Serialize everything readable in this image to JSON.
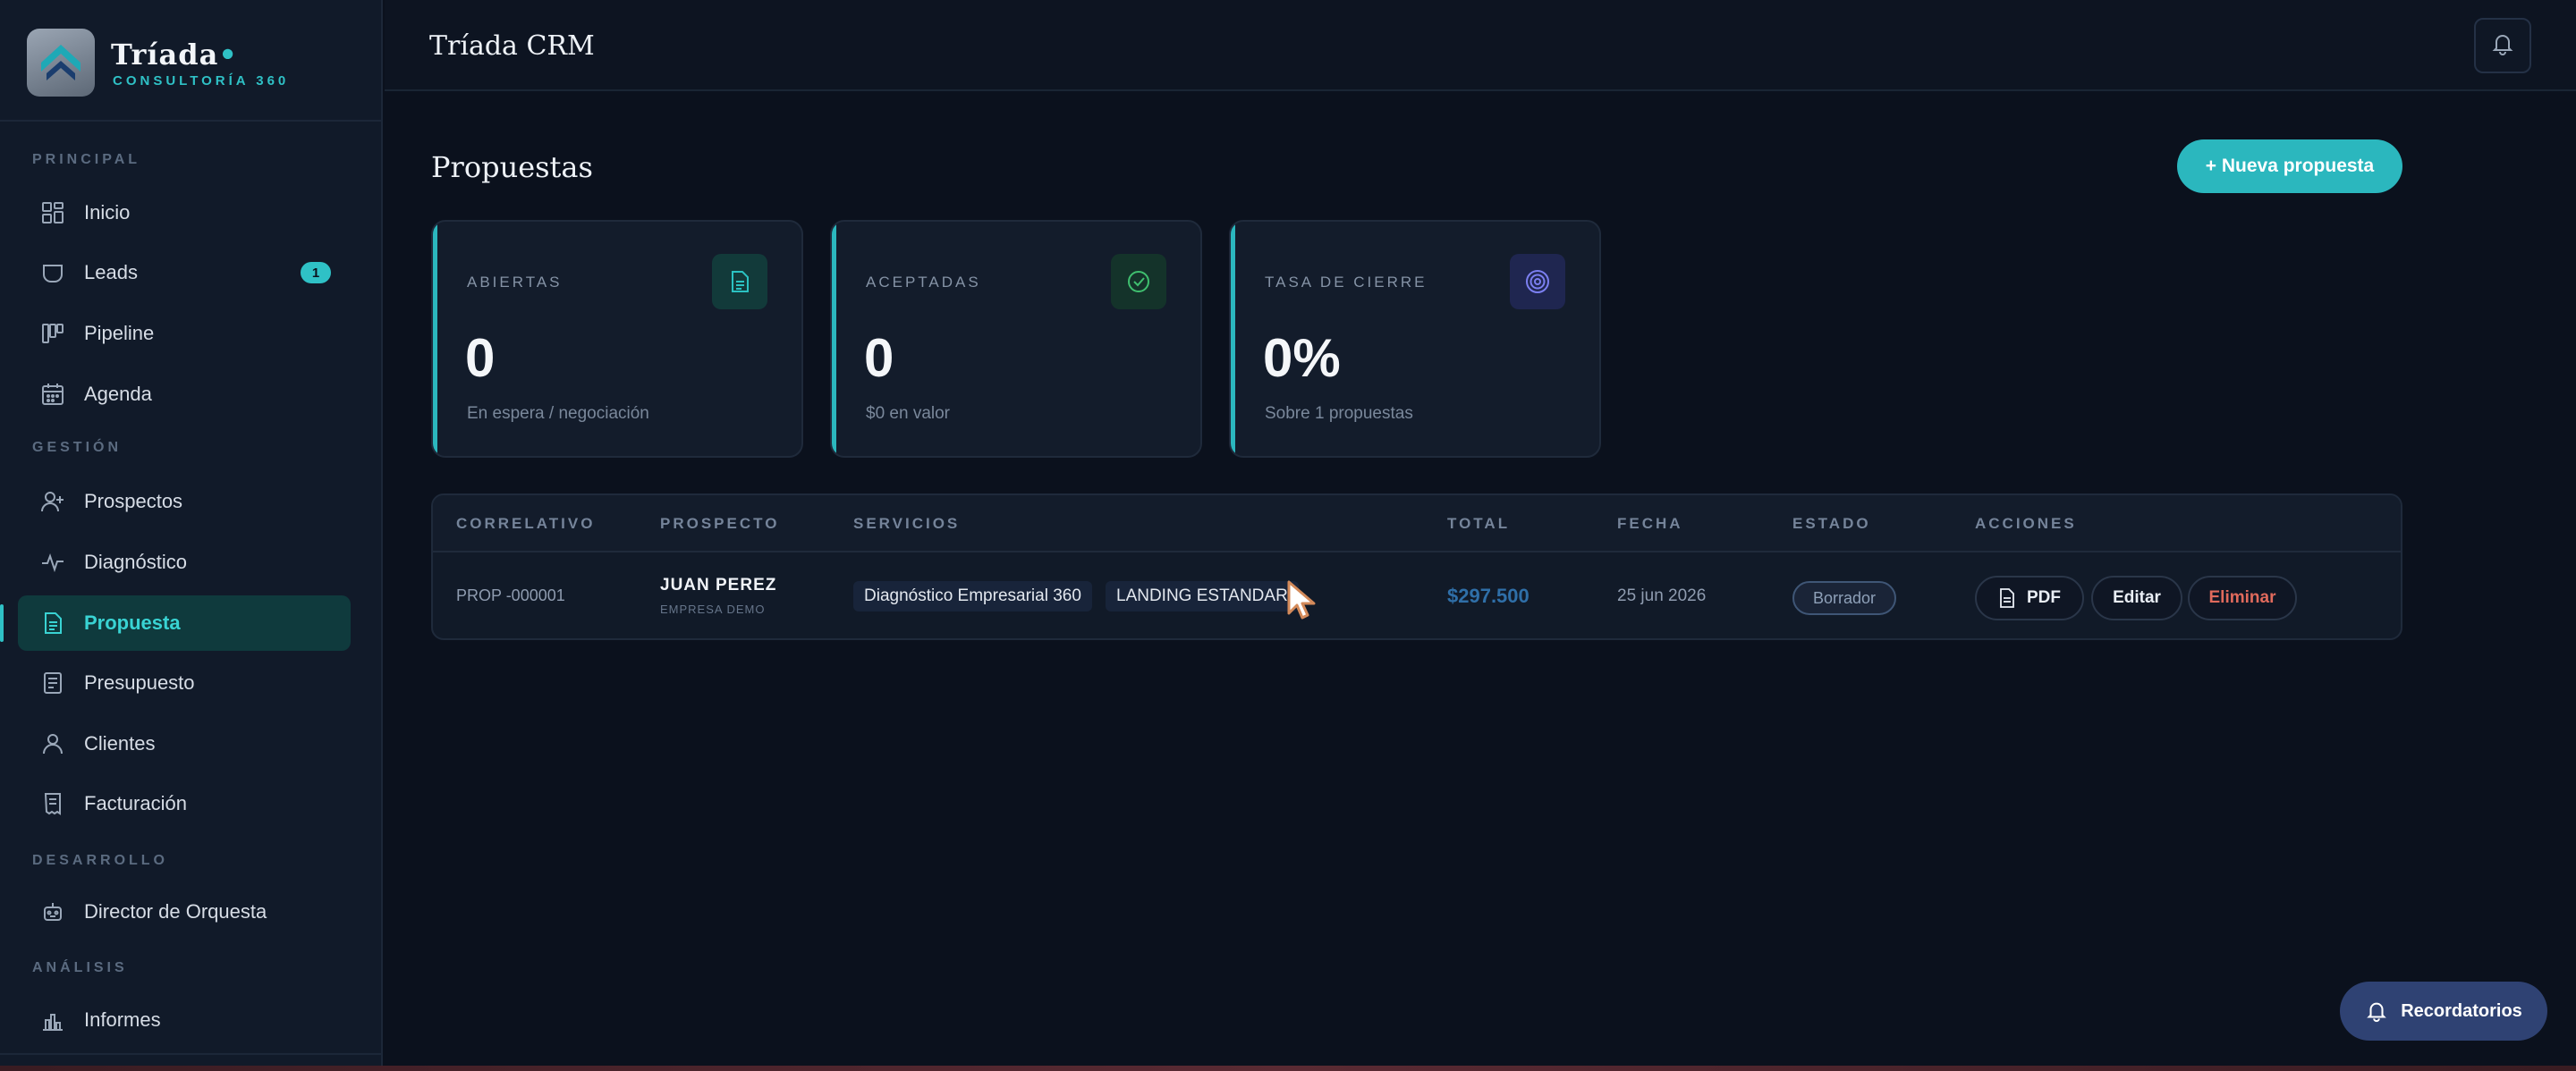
{
  "brand": {
    "name": "Tríada",
    "dot": "•",
    "subtitle": "CONSULTORÍA 360"
  },
  "sidebar": {
    "sections": [
      {
        "label": "PRINCIPAL"
      },
      {
        "label": "GESTIÓN"
      },
      {
        "label": "DESARROLLO"
      },
      {
        "label": "ANÁLISIS"
      }
    ],
    "items": [
      {
        "label": "Inicio",
        "icon": "grid-icon"
      },
      {
        "label": "Leads",
        "icon": "inbox-icon",
        "badge": "1"
      },
      {
        "label": "Pipeline",
        "icon": "kanban-icon"
      },
      {
        "label": "Agenda",
        "icon": "calendar-icon"
      },
      {
        "label": "Prospectos",
        "icon": "user-plus-icon"
      },
      {
        "label": "Diagnóstico",
        "icon": "activity-icon"
      },
      {
        "label": "Propuesta",
        "icon": "file-text-icon",
        "active": true
      },
      {
        "label": "Presupuesto",
        "icon": "document-icon"
      },
      {
        "label": "Clientes",
        "icon": "user-icon"
      },
      {
        "label": "Facturación",
        "icon": "receipt-icon"
      },
      {
        "label": "Director  de  Orquesta",
        "icon": "robot-icon"
      },
      {
        "label": "Informes",
        "icon": "bar-chart-icon"
      }
    ]
  },
  "header": {
    "title": "Tríada CRM",
    "bell_icon": "bell-icon"
  },
  "main": {
    "title": "Propuestas",
    "new_button": "+ Nueva  propuesta",
    "cards": [
      {
        "label": "ABIERTAS",
        "value": "0",
        "note": "En espera  / negociación",
        "icon": "file-text-icon",
        "accent": "#2bb7be"
      },
      {
        "label": "ACEPTADAS",
        "value": "0",
        "note": "$0 en valor",
        "icon": "check-circle-icon",
        "accent": "#3fbf6f"
      },
      {
        "label": "TASA DE CIERRE",
        "value": "0%",
        "note": "Sobre  1 propuestas",
        "icon": "target-icon",
        "accent": "#7b7ff0"
      }
    ],
    "table": {
      "columns": [
        "CORRELATIVO",
        "PROSPECTO",
        "SERVICIOS",
        "TOTAL",
        "FECHA",
        "ESTADO",
        "ACCIONES"
      ],
      "rows": [
        {
          "correlativo": "PROP -000001",
          "prospecto": "JUAN PEREZ",
          "empresa": "EMPRESA DEMO",
          "servicios": [
            "Diagnóstico   Empresarial   360",
            "LANDING   ESTANDAR"
          ],
          "total": "$297.500",
          "fecha": "25 jun 2026",
          "estado": "Borrador",
          "acciones": {
            "pdf": "PDF",
            "editar": "Editar",
            "eliminar": "Eliminar"
          }
        }
      ]
    }
  },
  "reminders_button": "Recordatorios",
  "colors": {
    "accent": "#2bb7be",
    "background": "#0b111d",
    "sidebar": "#111a29",
    "danger": "#e06a5c",
    "total": "#2f6fa8"
  }
}
